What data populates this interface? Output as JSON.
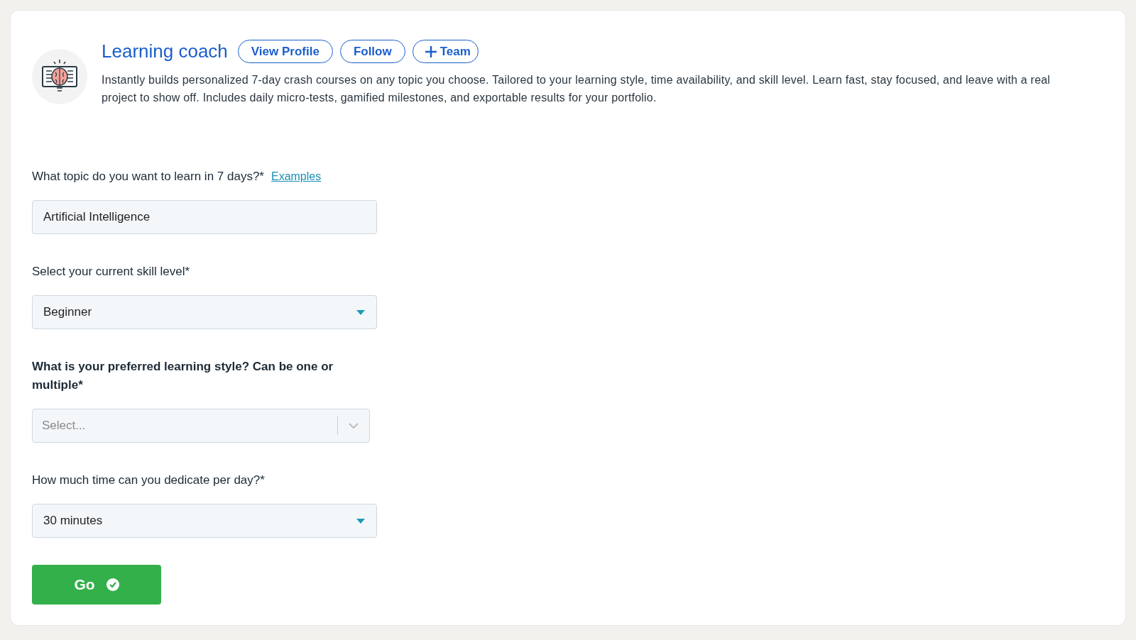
{
  "header": {
    "title": "Learning coach",
    "buttons": [
      {
        "label": "View Profile",
        "kind": "plain"
      },
      {
        "label": "Follow",
        "kind": "plain"
      },
      {
        "label": "Team",
        "kind": "add"
      }
    ],
    "description": "Instantly builds personalized 7-day crash courses on any topic you choose. Tailored to your learning style, time availability, and skill level. Learn fast, stay focused, and leave with a real project to show off. Includes daily micro-tests, gamified milestones, and exportable results for your portfolio."
  },
  "fields": [
    {
      "kind": "text",
      "label": "What topic do you want to learn in 7 days?*",
      "link": "Examples",
      "bold": false,
      "value": "Artificial Intelligence"
    },
    {
      "kind": "dropdown",
      "label": "Select your current skill level*",
      "bold": false,
      "value": "Beginner"
    },
    {
      "kind": "multiselect",
      "label": "What is your preferred learning style? Can be one or multiple*",
      "bold": true,
      "placeholder": "Select..."
    },
    {
      "kind": "dropdown",
      "label": "How much time can you dedicate per day?*",
      "bold": false,
      "value": "30 minutes"
    }
  ],
  "submit": {
    "label": "Go"
  }
}
